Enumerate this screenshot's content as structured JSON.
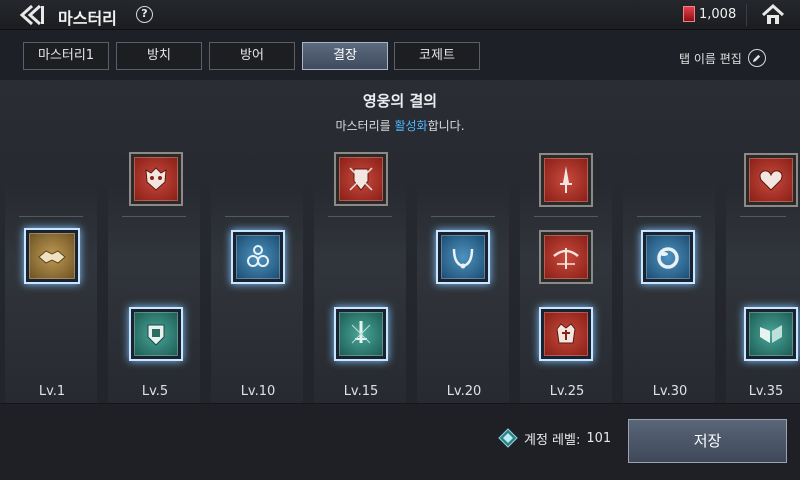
{
  "app": {
    "title": "마스터리",
    "help_label": "?",
    "currency_value": "1,008"
  },
  "tabs": [
    {
      "label": "마스터리1",
      "active": false
    },
    {
      "label": "방치",
      "active": false
    },
    {
      "label": "방어",
      "active": false
    },
    {
      "label": "결장",
      "active": true
    },
    {
      "label": "코제트",
      "active": false
    }
  ],
  "tab_edit_label": "탭 이름 편집",
  "header": {
    "title": "영웅의 결의",
    "sub_before": "마스터리를 ",
    "sub_highlight": "활성화",
    "sub_after": "합니다."
  },
  "levels": [
    "Lv.1",
    "Lv.5",
    "Lv.10",
    "Lv.15",
    "Lv.20",
    "Lv.25",
    "Lv.30",
    "Lv.35"
  ],
  "icons": {
    "handshake": "handshake-icon",
    "beast_mask": "beast-mask-icon",
    "castle_shield": "castle-shield-icon",
    "amulet": "amulet-icon",
    "shield_crest": "shield-crest-icon",
    "sword_crest": "sword-crest-icon",
    "necklace": "necklace-icon",
    "dagger": "dagger-icon",
    "crossbow": "crossbow-icon",
    "crown_crest": "crown-crest-icon",
    "ring": "ring-icon",
    "heart": "heart-icon",
    "winged_shield": "winged-shield-icon"
  },
  "colors": {
    "accent_blue": "#4db6ff",
    "active_tab": "#5c6a80",
    "red_tile": "#c94a3c",
    "teal_tile": "#4aa79a",
    "blue_tile": "#4d93c0"
  },
  "footer": {
    "account_level_label": "계정 레벨:",
    "account_level_value": "101",
    "save_label": "저장"
  }
}
